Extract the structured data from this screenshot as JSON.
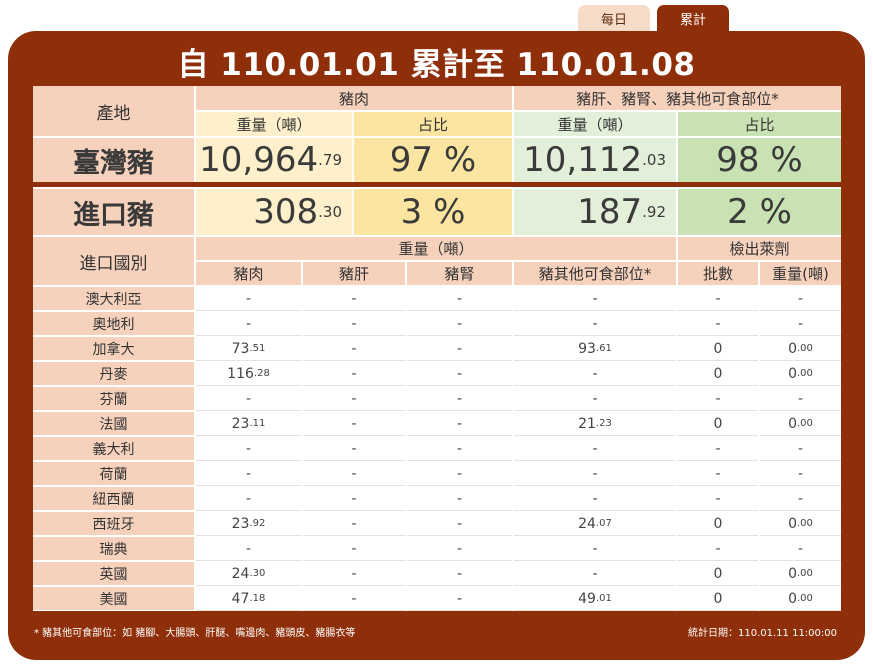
{
  "tabs": {
    "daily": "每日",
    "cumulative": "累計"
  },
  "title": "自 110.01.01 累計至 110.01.08",
  "header": {
    "origin": "產地",
    "pork": "豬肉",
    "offal": "豬肝、豬腎、豬其他可食部位*",
    "weight": "重量（噸）",
    "share": "占比"
  },
  "taiwan": {
    "label": "臺灣豬",
    "pork_int": "10,964",
    "pork_dec": ".79",
    "pork_share": "97 %",
    "offal_int": "10,112",
    "offal_dec": ".03",
    "offal_share": "98 %"
  },
  "imported": {
    "label": "進口豬",
    "pork_int": "308",
    "pork_dec": ".30",
    "pork_share": "3 %",
    "offal_int": "187",
    "offal_dec": ".92",
    "offal_share": "2 %"
  },
  "country_header": {
    "country": "進口國別",
    "weight": "重量（噸）",
    "ractopamine": "檢出萊劑",
    "pork": "豬肉",
    "liver": "豬肝",
    "kidney": "豬腎",
    "other": "豬其他可食部位*",
    "batches": "批數",
    "rac_weight": "重量(噸)"
  },
  "countries": [
    {
      "name": "澳大利亞",
      "pork": "-",
      "pork_dec": "",
      "liver": "-",
      "kidney": "-",
      "other": "-",
      "other_dec": "",
      "batches": "-",
      "rac_weight": "-",
      "rac_dec": ""
    },
    {
      "name": "奧地利",
      "pork": "-",
      "pork_dec": "",
      "liver": "-",
      "kidney": "-",
      "other": "-",
      "other_dec": "",
      "batches": "-",
      "rac_weight": "-",
      "rac_dec": ""
    },
    {
      "name": "加拿大",
      "pork": "73",
      "pork_dec": ".51",
      "liver": "-",
      "kidney": "-",
      "other": "93",
      "other_dec": ".61",
      "batches": "0",
      "rac_weight": "0",
      "rac_dec": ".00"
    },
    {
      "name": "丹麥",
      "pork": "116",
      "pork_dec": ".28",
      "liver": "-",
      "kidney": "-",
      "other": "-",
      "other_dec": "",
      "batches": "0",
      "rac_weight": "0",
      "rac_dec": ".00"
    },
    {
      "name": "芬蘭",
      "pork": "-",
      "pork_dec": "",
      "liver": "-",
      "kidney": "-",
      "other": "-",
      "other_dec": "",
      "batches": "-",
      "rac_weight": "-",
      "rac_dec": ""
    },
    {
      "name": "法國",
      "pork": "23",
      "pork_dec": ".11",
      "liver": "-",
      "kidney": "-",
      "other": "21",
      "other_dec": ".23",
      "batches": "0",
      "rac_weight": "0",
      "rac_dec": ".00"
    },
    {
      "name": "義大利",
      "pork": "-",
      "pork_dec": "",
      "liver": "-",
      "kidney": "-",
      "other": "-",
      "other_dec": "",
      "batches": "-",
      "rac_weight": "-",
      "rac_dec": ""
    },
    {
      "name": "荷蘭",
      "pork": "-",
      "pork_dec": "",
      "liver": "-",
      "kidney": "-",
      "other": "-",
      "other_dec": "",
      "batches": "-",
      "rac_weight": "-",
      "rac_dec": ""
    },
    {
      "name": "紐西蘭",
      "pork": "-",
      "pork_dec": "",
      "liver": "-",
      "kidney": "-",
      "other": "-",
      "other_dec": "",
      "batches": "-",
      "rac_weight": "-",
      "rac_dec": ""
    },
    {
      "name": "西班牙",
      "pork": "23",
      "pork_dec": ".92",
      "liver": "-",
      "kidney": "-",
      "other": "24",
      "other_dec": ".07",
      "batches": "0",
      "rac_weight": "0",
      "rac_dec": ".00"
    },
    {
      "name": "瑞典",
      "pork": "-",
      "pork_dec": "",
      "liver": "-",
      "kidney": "-",
      "other": "-",
      "other_dec": "",
      "batches": "-",
      "rac_weight": "-",
      "rac_dec": ""
    },
    {
      "name": "英國",
      "pork": "24",
      "pork_dec": ".30",
      "liver": "-",
      "kidney": "-",
      "other": "-",
      "other_dec": "",
      "batches": "0",
      "rac_weight": "0",
      "rac_dec": ".00"
    },
    {
      "name": "美國",
      "pork": "47",
      "pork_dec": ".18",
      "liver": "-",
      "kidney": "-",
      "other": "49",
      "other_dec": ".01",
      "batches": "0",
      "rac_weight": "0",
      "rac_dec": ".00"
    }
  ],
  "footnote": "* 豬其他可食部位：如 豬腳、大腸頭、肝醚、嘴邊肉、豬頭皮、豬腸衣等",
  "stat_date": "統計日期：110.01.11 11:00:00",
  "colors": {
    "panel": "#8f2f0a",
    "header": "#f6d2bd",
    "pork_light": "#fdf0cb",
    "pork_dark": "#fce5a0",
    "offal_light": "#e2f0d9",
    "offal_dark": "#c8e2b3"
  }
}
